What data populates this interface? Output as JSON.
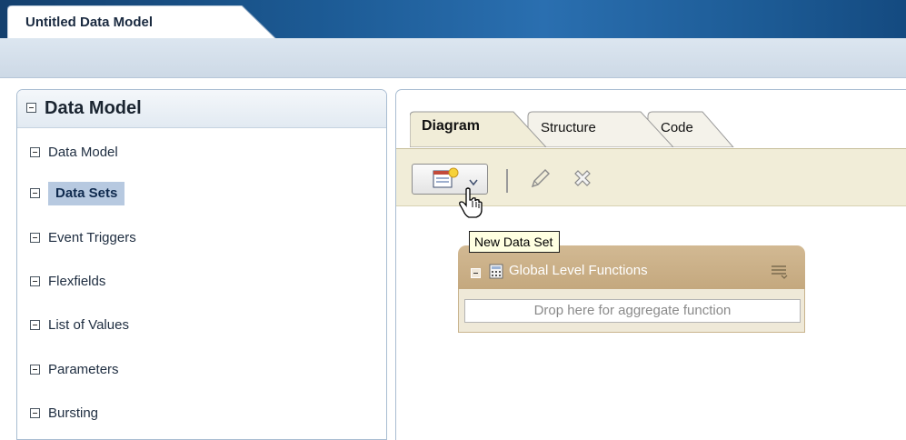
{
  "window": {
    "document_tab": "Untitled Data Model"
  },
  "left_panel": {
    "title": "Data Model",
    "tree_root": "Data Model",
    "items": [
      {
        "label": "Data Sets",
        "selected": true
      },
      {
        "label": "Event Triggers",
        "selected": false
      },
      {
        "label": "Flexfields",
        "selected": false
      },
      {
        "label": "List of Values",
        "selected": false
      },
      {
        "label": "Parameters",
        "selected": false
      },
      {
        "label": "Bursting",
        "selected": false
      }
    ]
  },
  "tabs": [
    {
      "label": "Diagram",
      "active": true
    },
    {
      "label": "Structure",
      "active": false
    },
    {
      "label": "Code",
      "active": false
    }
  ],
  "toolbar": {
    "new_data_set_icon": "new-data-set-icon",
    "edit_icon": "pencil-icon",
    "delete_icon": "delete-x-icon"
  },
  "tooltip": "New Data Set",
  "functions_panel": {
    "title": "Global Level Functions",
    "drop_hint": "Drop here for aggregate function"
  },
  "colors": {
    "banner": "#1c5a94",
    "selected_item": "#b7c9e0",
    "toolbar_bg": "#f1edd8",
    "func_header": "#c9ae84",
    "tooltip_bg": "#ffffe1"
  }
}
